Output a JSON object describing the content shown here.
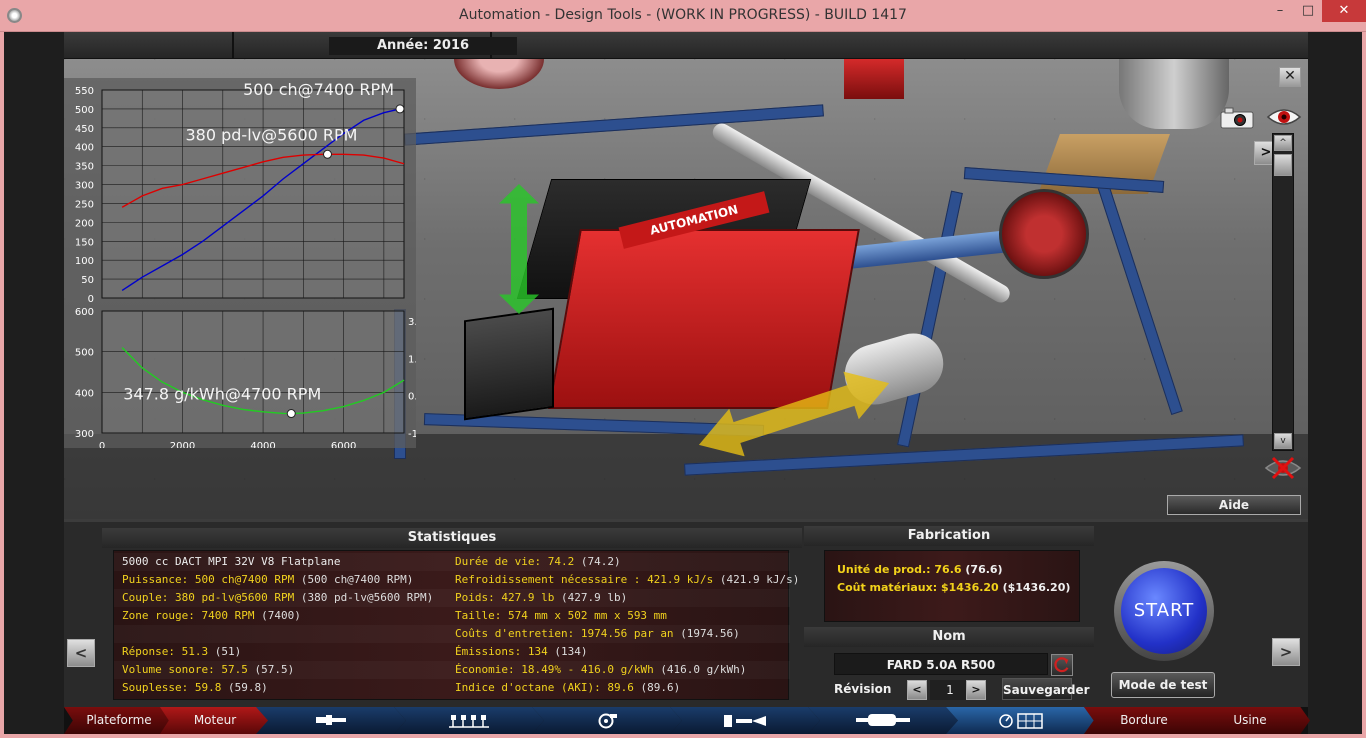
{
  "window": {
    "title": "Automation - Design Tools - (WORK IN PROGRESS) - BUILD 1417",
    "minimize": "–",
    "maximize": "□",
    "close": "✕"
  },
  "topbar": {
    "year_label": "Année: 2016",
    "close_label": "✕"
  },
  "chart_data": [
    {
      "type": "line",
      "title": "",
      "yticks": [
        0,
        50,
        100,
        150,
        200,
        250,
        300,
        350,
        400,
        450,
        500,
        550
      ],
      "ylim": [
        0,
        550
      ],
      "xlim": [
        0,
        7500
      ],
      "series": [
        {
          "name": "",
          "color": "#0000cc",
          "x": [
            500,
            1000,
            1500,
            2000,
            2500,
            3000,
            3500,
            4000,
            4500,
            5000,
            5500,
            6000,
            6500,
            7000,
            7400
          ],
          "y": [
            20,
            55,
            85,
            115,
            150,
            190,
            230,
            270,
            315,
            355,
            395,
            435,
            470,
            490,
            500
          ]
        },
        {
          "name": "",
          "color": "#dd0000",
          "x": [
            500,
            1000,
            1500,
            2000,
            2500,
            3000,
            3500,
            4000,
            4500,
            5000,
            5500,
            6000,
            6500,
            7000,
            7500
          ],
          "y": [
            240,
            270,
            290,
            300,
            315,
            330,
            345,
            360,
            372,
            378,
            380,
            380,
            378,
            370,
            355
          ]
        }
      ],
      "annotations": [
        {
          "text": "500 ch@7400 RPM",
          "x": 7400,
          "y": 500
        },
        {
          "text": "380 pd-lv@5600 RPM",
          "x": 5600,
          "y": 380
        }
      ]
    },
    {
      "type": "line",
      "title": "",
      "yticks": [
        300,
        400,
        500,
        600
      ],
      "ylim": [
        300,
        600
      ],
      "y2ticks": [
        "3.0",
        "1.7",
        "0.3",
        "-1.0"
      ],
      "xticks": [
        0,
        2000,
        4000,
        6000
      ],
      "xlim": [
        0,
        7500
      ],
      "series": [
        {
          "name": "",
          "color": "#22cc22",
          "x": [
            500,
            1000,
            1500,
            2000,
            2500,
            3000,
            3500,
            4000,
            4500,
            4700,
            5000,
            5500,
            6000,
            6500,
            7000,
            7500
          ],
          "y": [
            510,
            460,
            425,
            400,
            382,
            368,
            358,
            352,
            348,
            347.8,
            349,
            355,
            365,
            380,
            400,
            430
          ]
        }
      ],
      "annotations": [
        {
          "text": "347.8 g/kWh@4700 RPM",
          "x": 4700,
          "y": 347.8
        }
      ]
    }
  ],
  "viewport": {
    "camera_icon": "camera-icon",
    "eye_icon": "eye-icon",
    "nav_right": ">",
    "scroll_up": "^",
    "scroll_down": "v",
    "help_label": "Aide",
    "engine_logo": "AUTOMATION"
  },
  "stats": {
    "title": "Statistiques",
    "rows": [
      {
        "left": {
          "plain": "5000 cc DACT MPI 32V V8 Flatplane"
        },
        "right": {
          "lbl": "Durée de vie:",
          "val": "74.2",
          "ref": "(74.2)"
        }
      },
      {
        "left": {
          "lbl": "Puissance:",
          "val": "500 ch@7400 RPM",
          "ref": "(500 ch@7400 RPM)"
        },
        "right": {
          "lbl": "Refroidissement nécessaire :",
          "val": "421.9 kJ/s",
          "ref": "(421.9 kJ/s)"
        }
      },
      {
        "left": {
          "lbl": "Couple:",
          "val": "380 pd-lv@5600 RPM",
          "ref": "(380 pd-lv@5600 RPM)"
        },
        "right": {
          "lbl": "Poids:",
          "val": "427.9 lb",
          "ref": "(427.9 lb)"
        }
      },
      {
        "left": {
          "lbl": "Zone rouge:",
          "val": "7400 RPM",
          "ref": "(7400)"
        },
        "right": {
          "lbl": "Taille:",
          "val": "574 mm x 502 mm x 593 mm",
          "ref": ""
        }
      },
      {
        "left": {
          "plain": ""
        },
        "right": {
          "lbl": "Coûts d'entretien:",
          "val": "1974.56 par an",
          "ref": "(1974.56)"
        }
      },
      {
        "left": {
          "lbl": "Réponse:",
          "val": "51.3",
          "ref": "(51)"
        },
        "right": {
          "lbl": "Émissions:",
          "val": "134",
          "ref": "(134)"
        }
      },
      {
        "left": {
          "lbl": "Volume sonore:",
          "val": "57.5",
          "ref": "(57.5)"
        },
        "right": {
          "lbl": "Économie:",
          "val": "18.49% - 416.0 g/kWh",
          "ref": "(416.0 g/kWh)"
        }
      },
      {
        "left": {
          "lbl": "Souplesse:",
          "val": "59.8",
          "ref": "(59.8)"
        },
        "right": {
          "lbl": "Indice d'octane (AKI):",
          "val": "89.6",
          "ref": "(89.6)"
        }
      }
    ]
  },
  "fabrication": {
    "title": "Fabrication",
    "unit_label": "Unité de prod.:",
    "unit_value": "76.6",
    "unit_ref": "(76.6)",
    "cost_label": "Coût matériaux:",
    "cost_value": "$1436.20",
    "cost_ref": "($1436.20)"
  },
  "name_panel": {
    "title": "Nom",
    "engine_name": "FARD 5.0A R500",
    "revision_label": "Révision",
    "revision_value": "1",
    "prev": "<",
    "next": ">",
    "save_label": "Sauvegarder"
  },
  "actions": {
    "start_label": "START",
    "test_label": "Mode de test",
    "prev_page": "<",
    "next_page": ">"
  },
  "tabs": [
    {
      "label": "Plateforme"
    },
    {
      "label": "Moteur"
    },
    {
      "icon": "crankshaft-icon"
    },
    {
      "icon": "pistons-icon"
    },
    {
      "icon": "turbo-icon"
    },
    {
      "icon": "fuel-injection-icon"
    },
    {
      "icon": "exhaust-icon"
    },
    {
      "icon": "gauges-icon"
    },
    {
      "label": "Bordure"
    },
    {
      "label": "Usine"
    }
  ]
}
